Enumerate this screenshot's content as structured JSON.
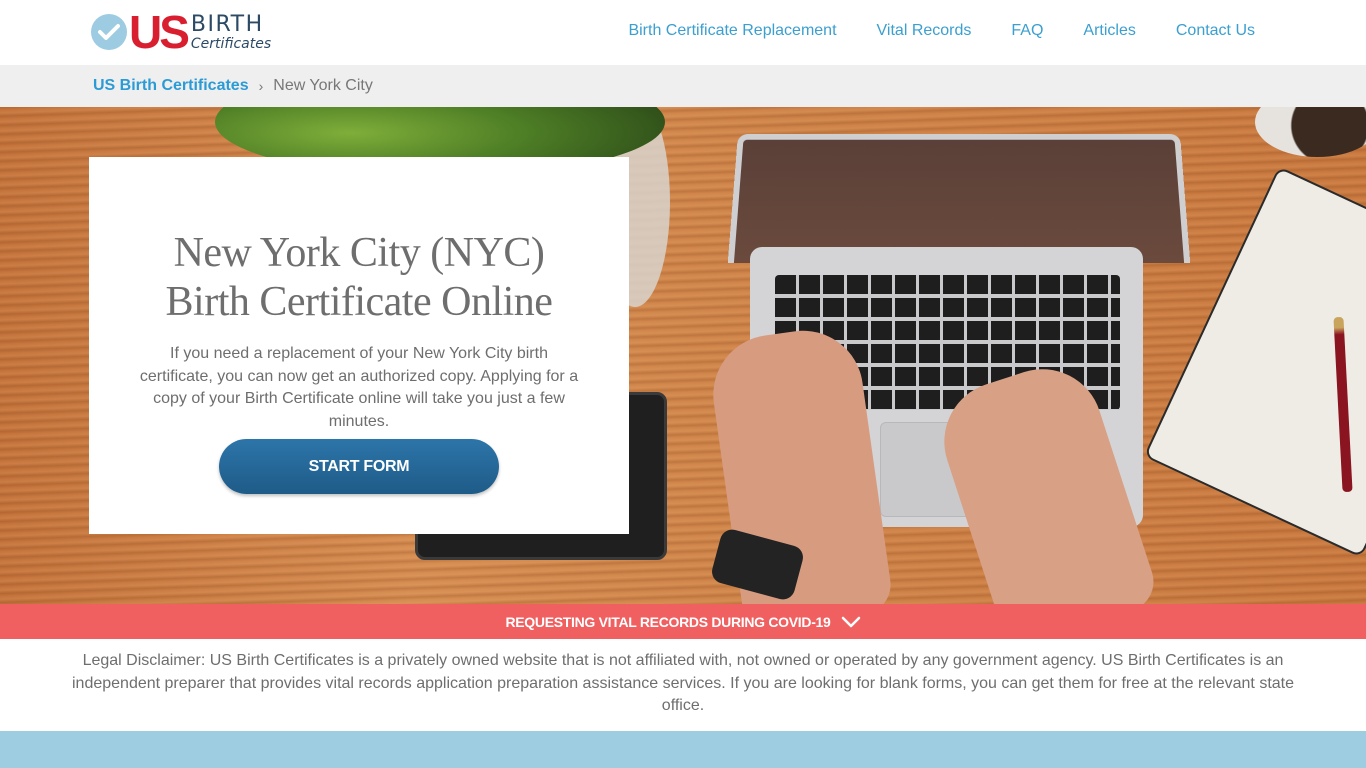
{
  "header": {
    "logo": {
      "check_icon": "check-circle-icon",
      "us": "US",
      "birth": "BIRTH",
      "certificates": "Certificates"
    },
    "nav": [
      {
        "label": "Birth Certificate Replacement"
      },
      {
        "label": "Vital Records"
      },
      {
        "label": "FAQ"
      },
      {
        "label": "Articles"
      },
      {
        "label": "Contact Us"
      }
    ]
  },
  "breadcrumb": {
    "home": "US Birth Certificates",
    "separator": "›",
    "current": "New York City"
  },
  "hero": {
    "title_line1": "New York City (NYC)",
    "title_line2": "Birth Certificate Online",
    "description": "If you need a replacement of your New York City birth certificate, you can now get an authorized copy. Applying for a copy of your Birth Certificate online will take you just a few minutes.",
    "cta_label": "START FORM"
  },
  "covid_banner": {
    "label": "REQUESTING VITAL RECORDS DURING COVID-19",
    "icon": "chevron-down-icon"
  },
  "disclaimer": "Legal Disclaimer: US Birth Certificates is a privately owned website that is not affiliated with, not owned or operated by any government agency. US Birth Certificates is an independent preparer that provides vital records application preparation assistance services. If you are looking for blank forms, you can get them for free at the relevant state office.",
  "colors": {
    "brand_red": "#d91f2f",
    "brand_navy": "#2c4a66",
    "link_blue": "#3b9fd0",
    "button_blue": "#2d75a9",
    "covid_red": "#f06060",
    "footer_blue": "#9ecde1"
  }
}
